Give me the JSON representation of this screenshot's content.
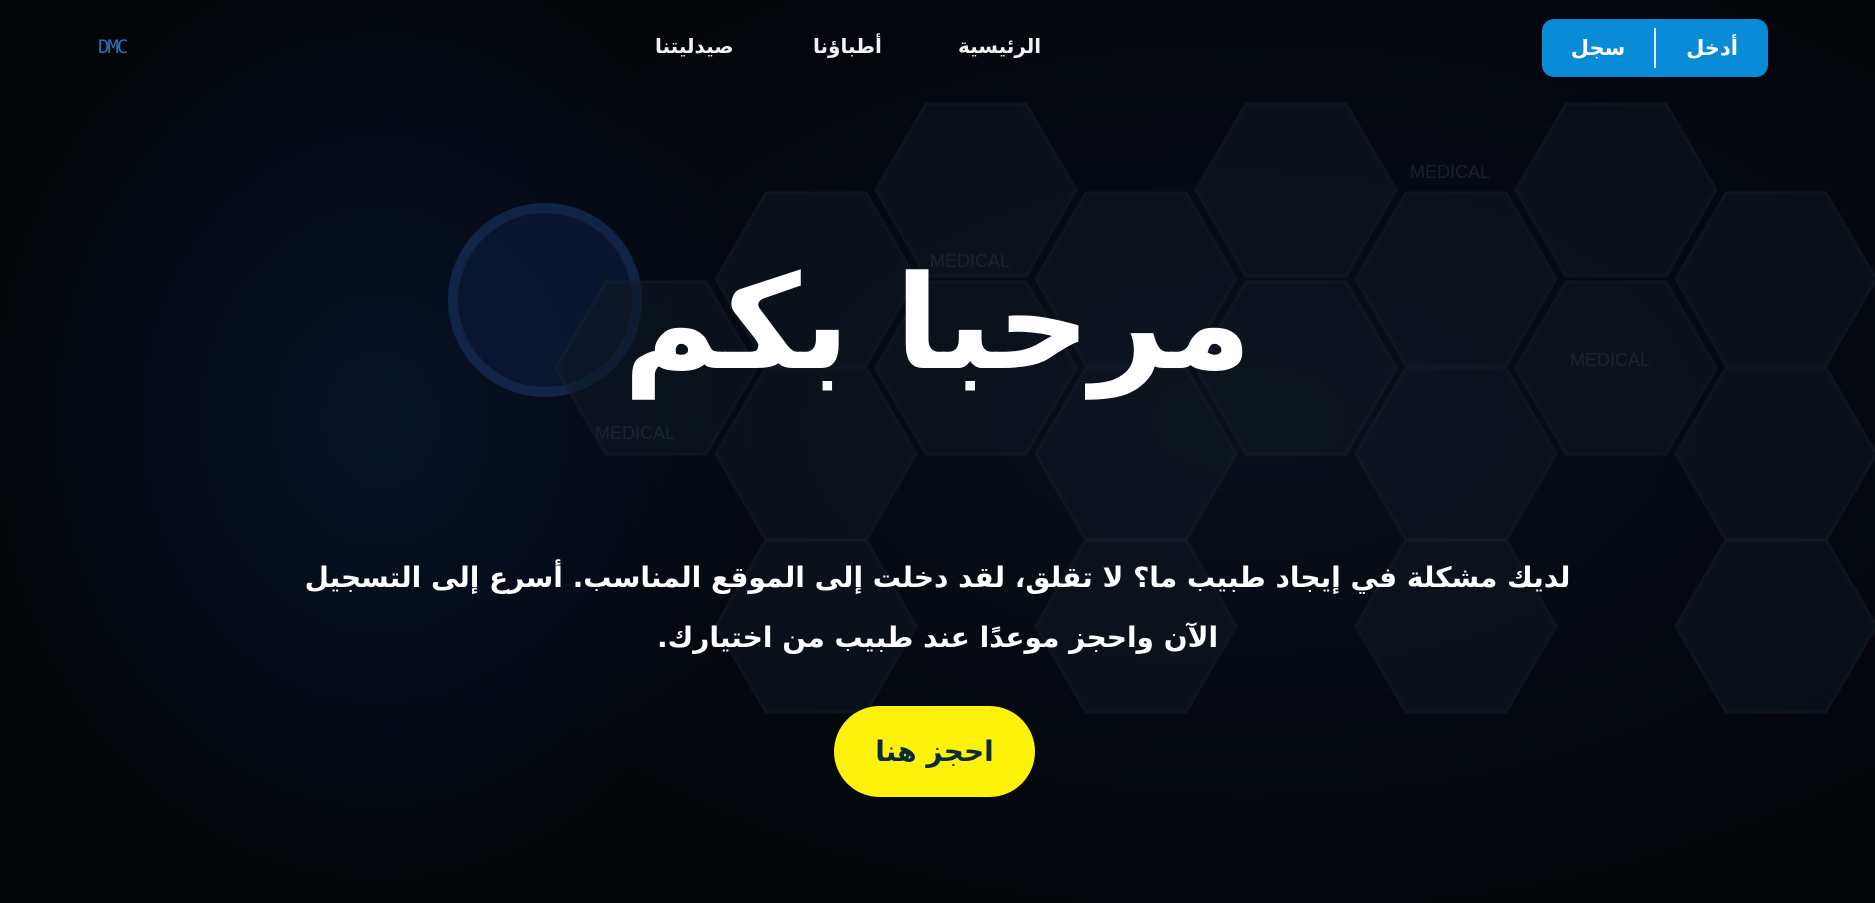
{
  "logo": {
    "text": "DMC"
  },
  "nav": {
    "home": "الرئيسية",
    "doctors": "أطباؤنا",
    "pharmacy": "صيدليتنا"
  },
  "auth": {
    "login": "أدخل",
    "register": "سجل"
  },
  "hero": {
    "title": "مرحبا بكم",
    "subtitle": "لديك مشكلة في إيجاد طبيب ما؟ لا تقلق، لقد دخلت إلى الموقع المناسب. أسرع إلى التسجيل الآن واحجز موعدًا عند طبيب من اختيارك.",
    "cta": "احجز هنا"
  },
  "background": {
    "hex_labels": [
      "MEDICAL",
      "MEDICAL",
      "MEDICAL",
      "MEDICAL"
    ]
  },
  "colors": {
    "auth_bg": "#0a8bd8",
    "cta_bg": "#fff20a",
    "cta_text": "#0a2b3d",
    "logo": "#2b6fb3"
  }
}
